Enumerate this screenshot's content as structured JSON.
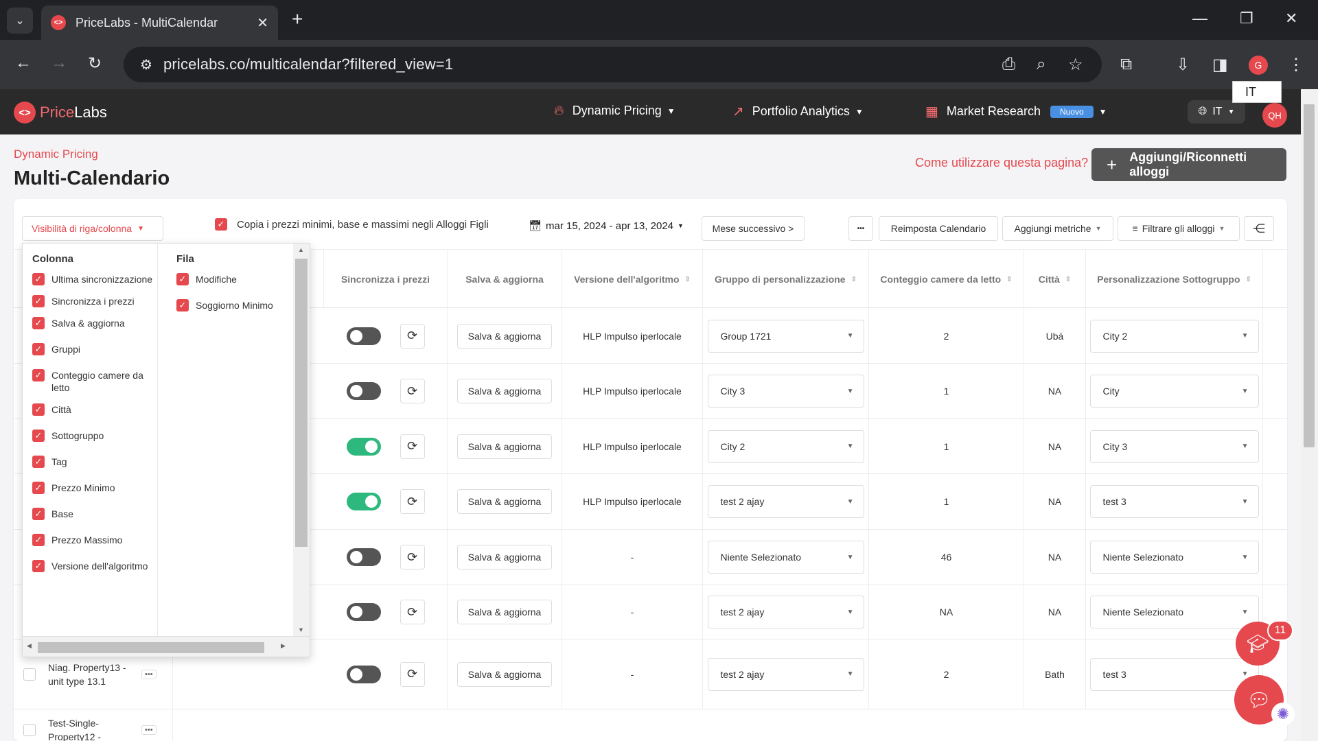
{
  "browser": {
    "tab_title": "PriceLabs - MultiCalendar",
    "url": "pricelabs.co/multicalendar?filtered_view=1",
    "profile_initial": "G"
  },
  "header": {
    "logo_prefix": "Price",
    "logo_suffix": "Labs",
    "menu": {
      "dynamic_pricing": "Dynamic Pricing",
      "portfolio_analytics": "Portfolio Analytics",
      "market_research": "Market Research",
      "market_badge": "Nuovo"
    },
    "language": "IT",
    "language_popup": "IT",
    "avatar": "QH"
  },
  "page": {
    "breadcrumb": "Dynamic Pricing",
    "title": "Multi-Calendario",
    "help_link": "Come utilizzare questa pagina?",
    "add_button": "Aggiungi/Riconnetti alloggi"
  },
  "toolbar": {
    "visibility": "Visibilità di riga/colonna",
    "copy_prices": "Copia i prezzi minimi, base e massimi negli Alloggi Figli",
    "date_range": "mar 15, 2024 - apr 13, 2024",
    "next_month": "Mese successivo >",
    "more": "•••",
    "reset": "Reimposta Calendario",
    "add_metrics": "Aggiungi metriche",
    "filter": "Filtrare gli alloggi"
  },
  "table": {
    "headers": {
      "sync": "Sincronizza i prezzi",
      "save": "Salva & aggiorna",
      "algo": "Versione dell'algoritmo",
      "group": "Gruppo di personalizzazione",
      "bedrooms": "Conteggio camere da letto",
      "city": "Città",
      "subgroup": "Personalizzazione Sottogruppo"
    },
    "rows": [
      {
        "save": "Salva & aggiorna",
        "algo": "HLP Impulso iperlocale",
        "group": "Group 1721",
        "bedrooms": "2",
        "city": "Ubá",
        "subgroup": "City 2",
        "sync_on": false
      },
      {
        "save": "Salva & aggiorna",
        "algo": "HLP Impulso iperlocale",
        "group": "City 3",
        "bedrooms": "1",
        "city": "NA",
        "subgroup": "City",
        "sync_on": false
      },
      {
        "save": "Salva & aggiorna",
        "algo": "HLP Impulso iperlocale",
        "group": "City 2",
        "bedrooms": "1",
        "city": "NA",
        "subgroup": "City 3",
        "sync_on": true
      },
      {
        "save": "Salva & aggiorna",
        "algo": "HLP Impulso iperlocale",
        "group": "test 2 ajay",
        "bedrooms": "1",
        "city": "NA",
        "subgroup": "test 3",
        "sync_on": true
      },
      {
        "save": "Salva & aggiorna",
        "algo": "-",
        "group": "Niente Selezionato",
        "bedrooms": "46",
        "city": "NA",
        "subgroup": "Niente Selezionato",
        "sync_on": false
      },
      {
        "save": "Salva & aggiorna",
        "algo": "-",
        "group": "test 2 ajay",
        "bedrooms": "NA",
        "city": "NA",
        "subgroup": "Niente Selezionato",
        "sync_on": false
      },
      {
        "save": "Salva & aggiorna",
        "algo": "-",
        "group": "test 2 ajay",
        "bedrooms": "2",
        "city": "Bath",
        "subgroup": "test 3",
        "sync_on": false,
        "listing_name": "Niag. Property13 - unit type 13.1"
      },
      {
        "listing_name": "Test-Single-Property12 -"
      }
    ]
  },
  "visibility_panel": {
    "column_heading": "Colonna",
    "row_heading": "Fila",
    "columns": [
      "Ultima sincronizzazione",
      "Sincronizza i prezzi",
      "Salva & aggiorna",
      "Gruppi",
      "Conteggio camere da letto",
      "Città",
      "Sottogruppo",
      "Tag",
      "Prezzo Minimo",
      "Base",
      "Prezzo Massimo",
      "Versione dell'algoritmo"
    ],
    "rows": [
      "Modifiche",
      "Soggiorno Minimo"
    ]
  },
  "widgets": {
    "notification_count": "11"
  },
  "colors": {
    "brand": "#e5484d",
    "toggle_on": "#2db87d",
    "header_bg": "#2a2a2a"
  }
}
